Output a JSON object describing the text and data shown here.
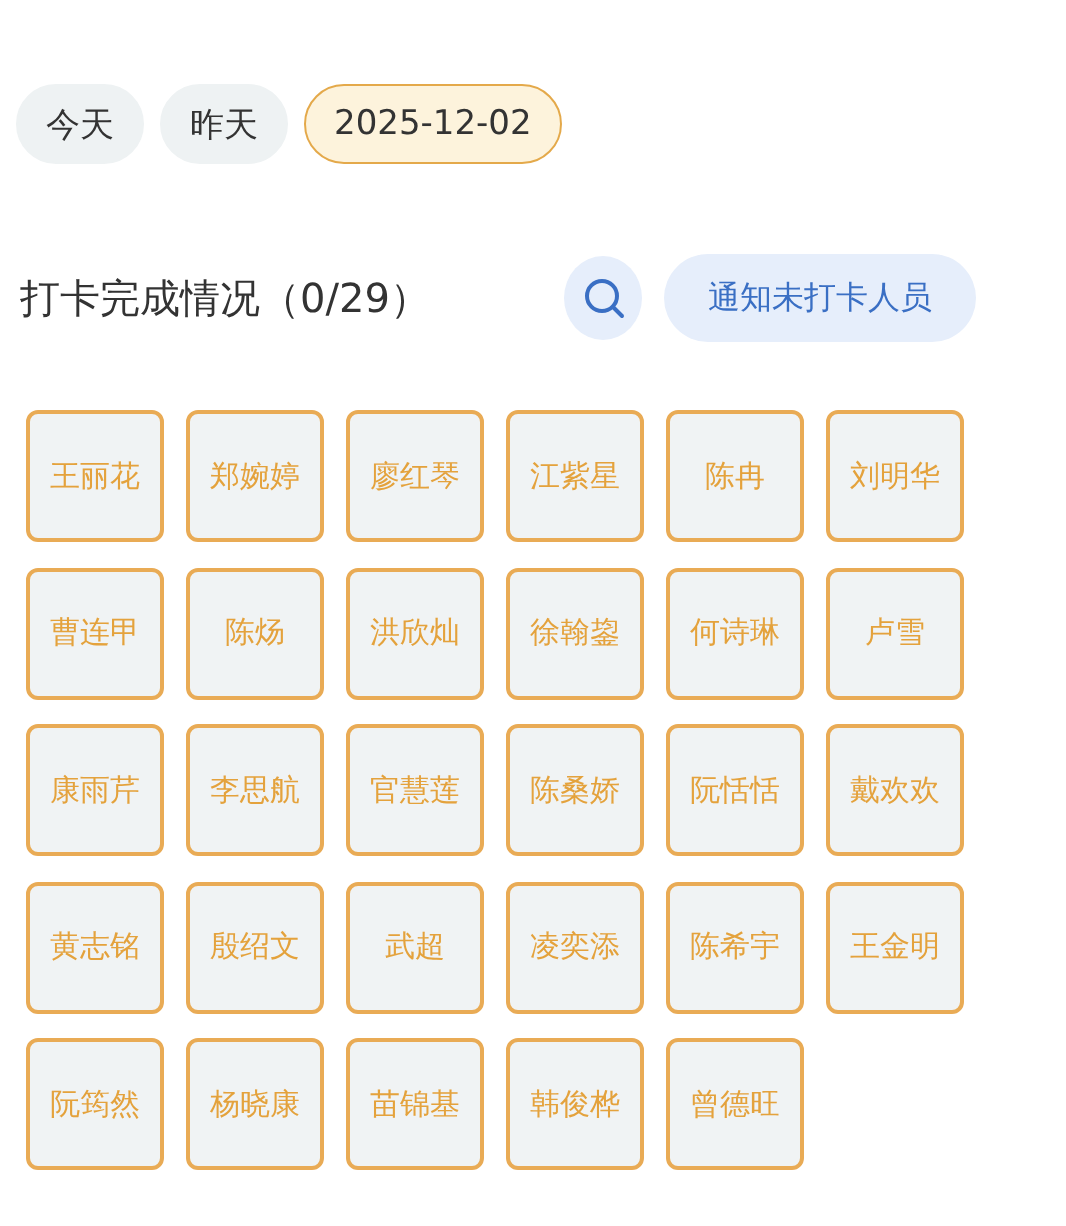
{
  "date_filters": [
    {
      "label": "今天",
      "selected": false
    },
    {
      "label": "昨天",
      "selected": false
    },
    {
      "label": "2025-12-02",
      "selected": true
    }
  ],
  "section": {
    "title": "打卡完成情况（0/29）",
    "notify_button": "通知未打卡人员"
  },
  "people": [
    "王丽花",
    "郑婉婷",
    "廖红琴",
    "江紫星",
    "陈冉",
    "刘明华",
    "曹连甲",
    "陈炀",
    "洪欣灿",
    "徐翰鋆",
    "何诗琳",
    "卢雪",
    "康雨芹",
    "李思航",
    "官慧莲",
    "陈桑娇",
    "阮恬恬",
    "戴欢欢",
    "黄志铭",
    "殷绍文",
    "武超",
    "凌奕添",
    "陈希宇",
    "王金明",
    "阮筠然",
    "杨晓康",
    "苗锦基",
    "韩俊桦",
    "曾德旺"
  ]
}
